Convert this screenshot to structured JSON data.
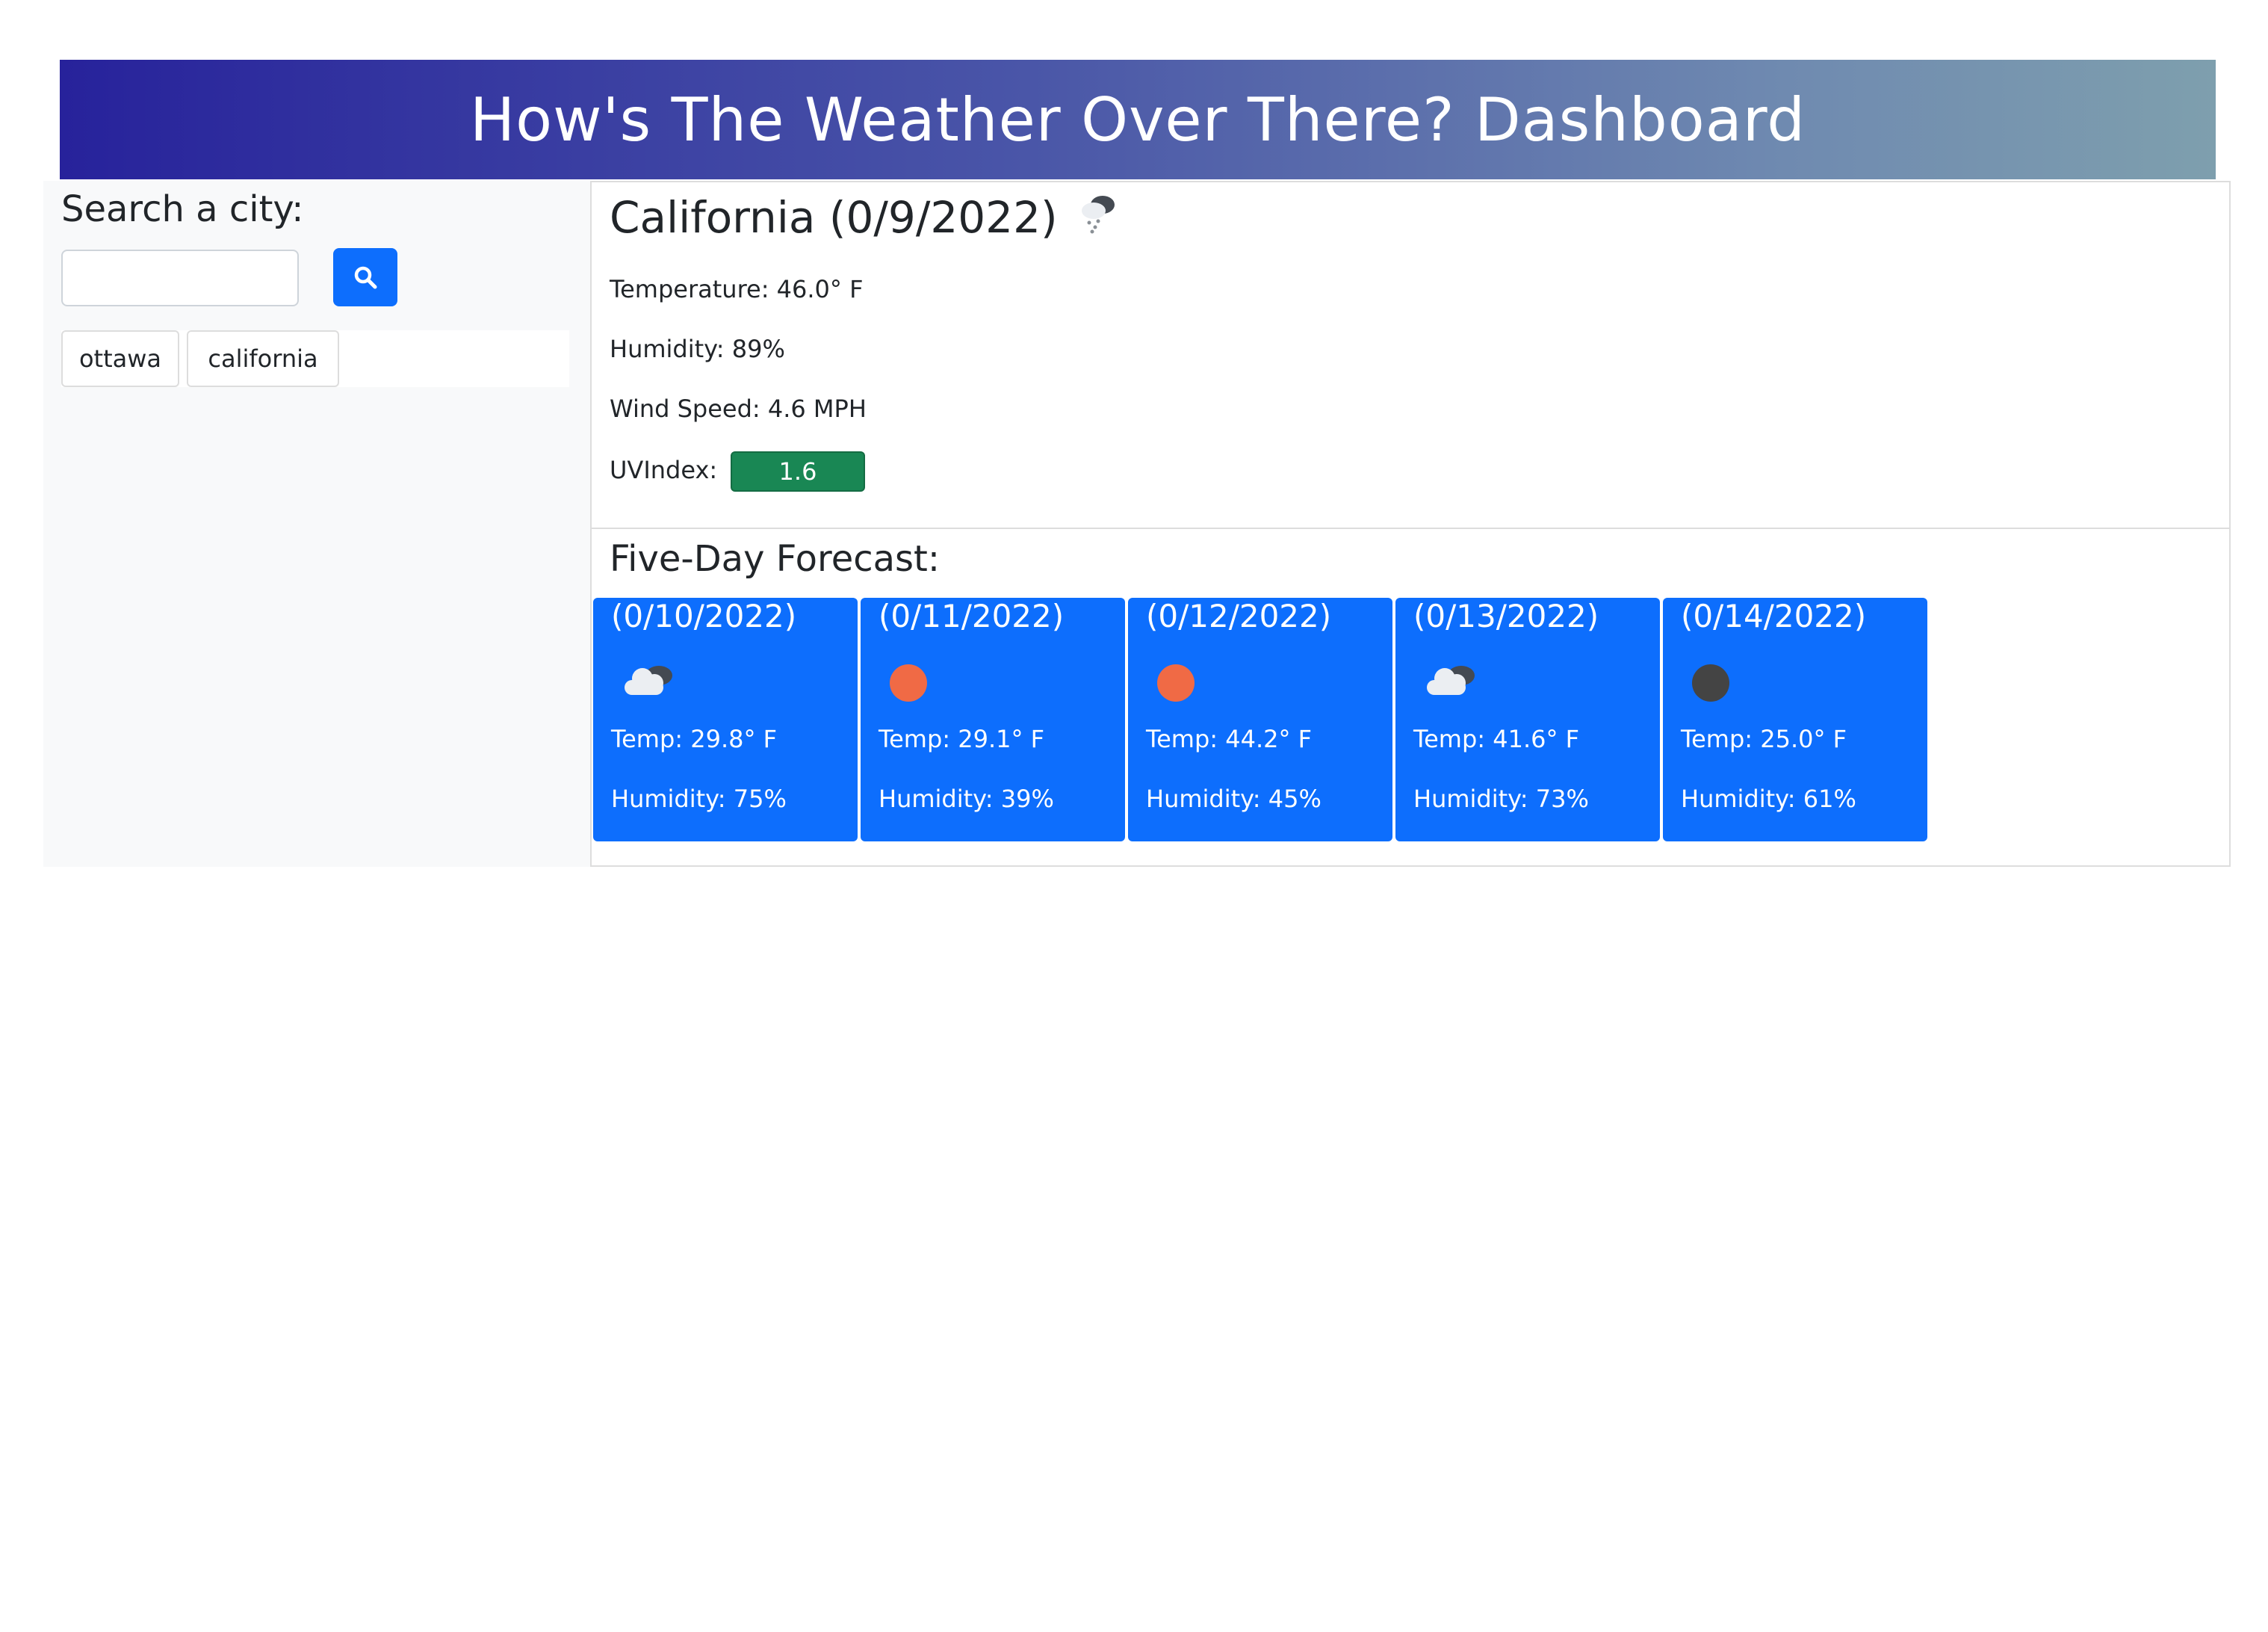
{
  "header": {
    "title": "How's The Weather Over There? Dashboard"
  },
  "sidebar": {
    "title": "Search a city:",
    "search": {
      "value": "",
      "placeholder": ""
    },
    "history": [
      {
        "label": "ottawa"
      },
      {
        "label": "california"
      }
    ]
  },
  "current": {
    "title": "California (0/9/2022)",
    "icon": "snow-cloud-icon",
    "temperature": "Temperature: 46.0° F",
    "humidity": "Humidity: 89%",
    "wind": "Wind Speed: 4.6 MPH",
    "uv_label": "UVIndex:",
    "uv_value": "1.6",
    "uv_color": "#198754"
  },
  "forecast": {
    "title": "Five-Day Forecast:",
    "days": [
      {
        "date": "(0/10/2022)",
        "icon": "cloud-icon",
        "temp": "Temp: 29.8° F",
        "humidity": "Humidity: 75%"
      },
      {
        "date": "(0/11/2022)",
        "icon": "sun-icon",
        "temp": "Temp: 29.1° F",
        "humidity": "Humidity: 39%"
      },
      {
        "date": "(0/12/2022)",
        "icon": "sun-icon",
        "temp": "Temp: 44.2° F",
        "humidity": "Humidity: 45%"
      },
      {
        "date": "(0/13/2022)",
        "icon": "cloud-icon",
        "temp": "Temp: 41.6° F",
        "humidity": "Humidity: 73%"
      },
      {
        "date": "(0/14/2022)",
        "icon": "moon-icon",
        "temp": "Temp: 25.0° F",
        "humidity": "Humidity: 61%"
      }
    ]
  },
  "colors": {
    "accent": "#0d6efd",
    "sun": "#f06a45",
    "moon": "#444444",
    "banner_start": "#27229b",
    "banner_end": "#7e9fae"
  }
}
